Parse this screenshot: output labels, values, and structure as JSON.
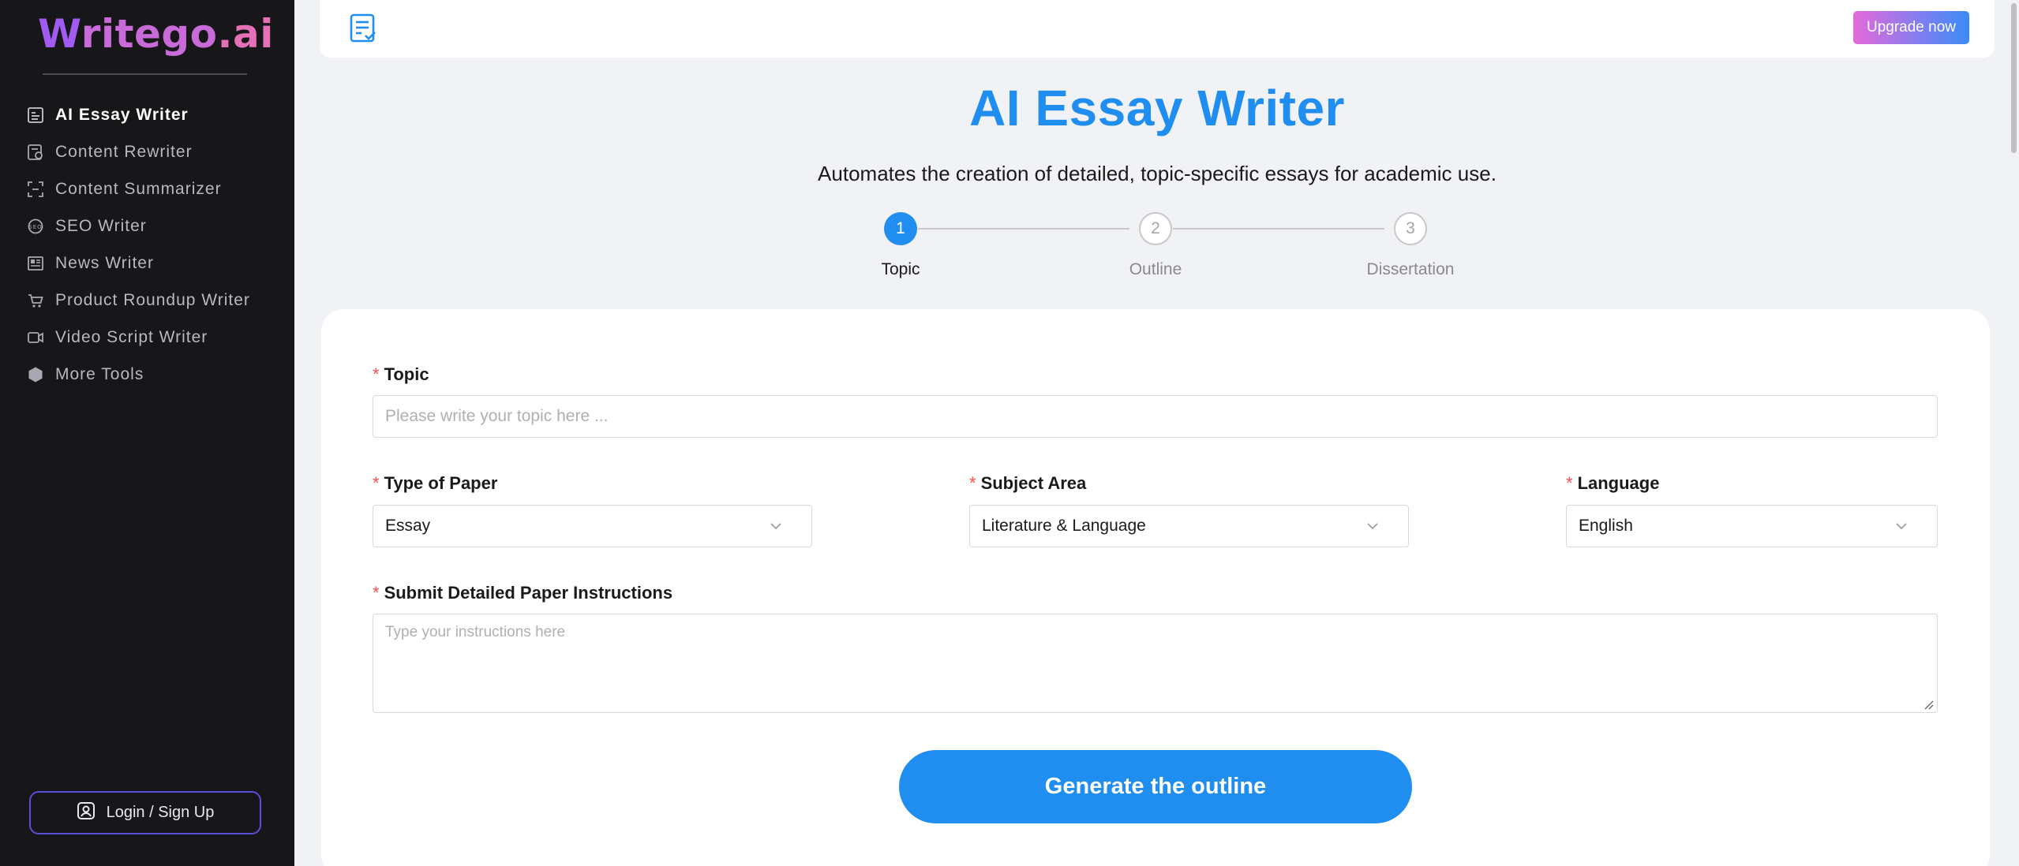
{
  "brand": {
    "logo_w": "W",
    "logo_rest": "ritego",
    "logo_ai": ".ai"
  },
  "sidebar": {
    "items": [
      {
        "label": "AI Essay Writer",
        "icon": "essay-icon",
        "active": true
      },
      {
        "label": "Content Rewriter",
        "icon": "rewrite-icon",
        "active": false
      },
      {
        "label": "Content Summarizer",
        "icon": "summarize-icon",
        "active": false
      },
      {
        "label": "SEO Writer",
        "icon": "seo-icon",
        "active": false
      },
      {
        "label": "News Writer",
        "icon": "news-icon",
        "active": false
      },
      {
        "label": "Product Roundup Writer",
        "icon": "cart-icon",
        "active": false
      },
      {
        "label": "Video Script Writer",
        "icon": "video-icon",
        "active": false
      },
      {
        "label": "More Tools",
        "icon": "hexagon-icon",
        "active": false
      }
    ],
    "login_label": "Login / Sign Up"
  },
  "topbar": {
    "upgrade_label": "Upgrade now"
  },
  "header": {
    "title": "AI Essay Writer",
    "subtitle": "Automates the creation of detailed, topic-specific essays for academic use."
  },
  "steps": [
    {
      "number": "1",
      "label": "Topic"
    },
    {
      "number": "2",
      "label": "Outline"
    },
    {
      "number": "3",
      "label": "Dissertation"
    }
  ],
  "form": {
    "required_mark": "*",
    "topic": {
      "label": "Topic",
      "placeholder": "Please write your topic here ..."
    },
    "paper_type": {
      "label": "Type of Paper",
      "value": "Essay"
    },
    "subject": {
      "label": "Subject Area",
      "value": "Literature & Language"
    },
    "language": {
      "label": "Language",
      "value": "English"
    },
    "instructions": {
      "label": "Submit Detailed Paper Instructions",
      "placeholder": "Type your instructions here"
    },
    "generate_label": "Generate the outline"
  },
  "colors": {
    "accent": "#1f8ef0",
    "sidebar_bg": "#17171a",
    "required": "#ff4d4f",
    "login_border": "#5b4fd8"
  }
}
